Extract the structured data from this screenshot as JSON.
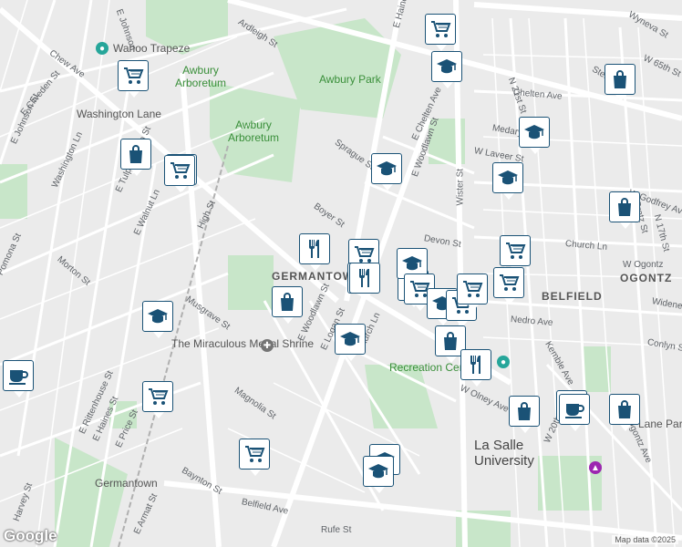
{
  "map": {
    "areas": {
      "awbury_park": "Awbury Park",
      "awbury_arboretum_1": "Awbury Arboretum",
      "awbury_arboretum_2": "Awbury Arboretum",
      "germantown": "GERMANTOWN",
      "ogontz": "OGONTZ",
      "belfield": "BELFIELD",
      "la_salle": "La Salle University",
      "recreation": "Recreation Center",
      "wahoo": "Wahoo Trapeze",
      "shrine": "The Miraculous Medal Shrine",
      "washington_lane": "Washington Lane",
      "germantown_station": "Germantown",
      "lane_park": "Lane Park"
    },
    "streets": [
      "Ardleigh St",
      "Chew Ave",
      "E Johnson St",
      "E Cliveden St",
      "Washington Ln",
      "E Tulpehocken St",
      "E Walnut Ln",
      "High St",
      "Morton St",
      "Pomona St",
      "Musgrave St",
      "E Haines St",
      "E Rittenhouse St",
      "E Price St",
      "Harvey St",
      "Baynton St",
      "Belfield Ave",
      "Rufe St",
      "E Armat St",
      "Magnolia St",
      "Church Ln",
      "E Woodlawn St",
      "E Logan St",
      "Boyer St",
      "Sprague St",
      "E Woodlawn St",
      "E Chelten Ave",
      "Chelten Ave",
      "Wister St",
      "Devon St",
      "W Laveer St",
      "Medary Ave",
      "W 65th St",
      "W Godfrey Ave",
      "Church Ln",
      "Nedro Ave",
      "Kemble Ave",
      "W 20th St",
      "N Gratz St",
      "N 21st St",
      "Conlyn St",
      "Widener Pl",
      "W Olney Ave",
      "Ogontz Ave",
      "N 17th St",
      "W Ogontz",
      "Stenton Ave",
      "Wyneva St",
      "E Haines St",
      "E Johnson"
    ],
    "pins": [
      "store-icon",
      "school-icon",
      "store-icon",
      "store-icon",
      "school-icon",
      "store-icon",
      "school-icon",
      "school-icon",
      "bag-icon",
      "bag-icon",
      "store-icon",
      "store-icon",
      "bag-icon",
      "restaurant-icon",
      "restaurant-icon",
      "store-icon",
      "school-icon",
      "store-icon",
      "school-icon",
      "restaurant-icon",
      "store-icon",
      "store-icon",
      "store-icon",
      "bag-icon",
      "school-icon",
      "school-icon",
      "school-icon",
      "restaurant-icon",
      "coffee-icon",
      "store-icon",
      "school-icon",
      "store-icon",
      "bag-icon",
      "coffee-icon",
      "bag-icon",
      "bag-icon",
      "coffee-icon"
    ],
    "attribution": "Map data ©2025",
    "logo": "Google"
  },
  "colors": {
    "road": "#ffffff",
    "park": "#c8e6c9",
    "pin_border": "#1a5276",
    "pin_icon": "#1a5276"
  }
}
